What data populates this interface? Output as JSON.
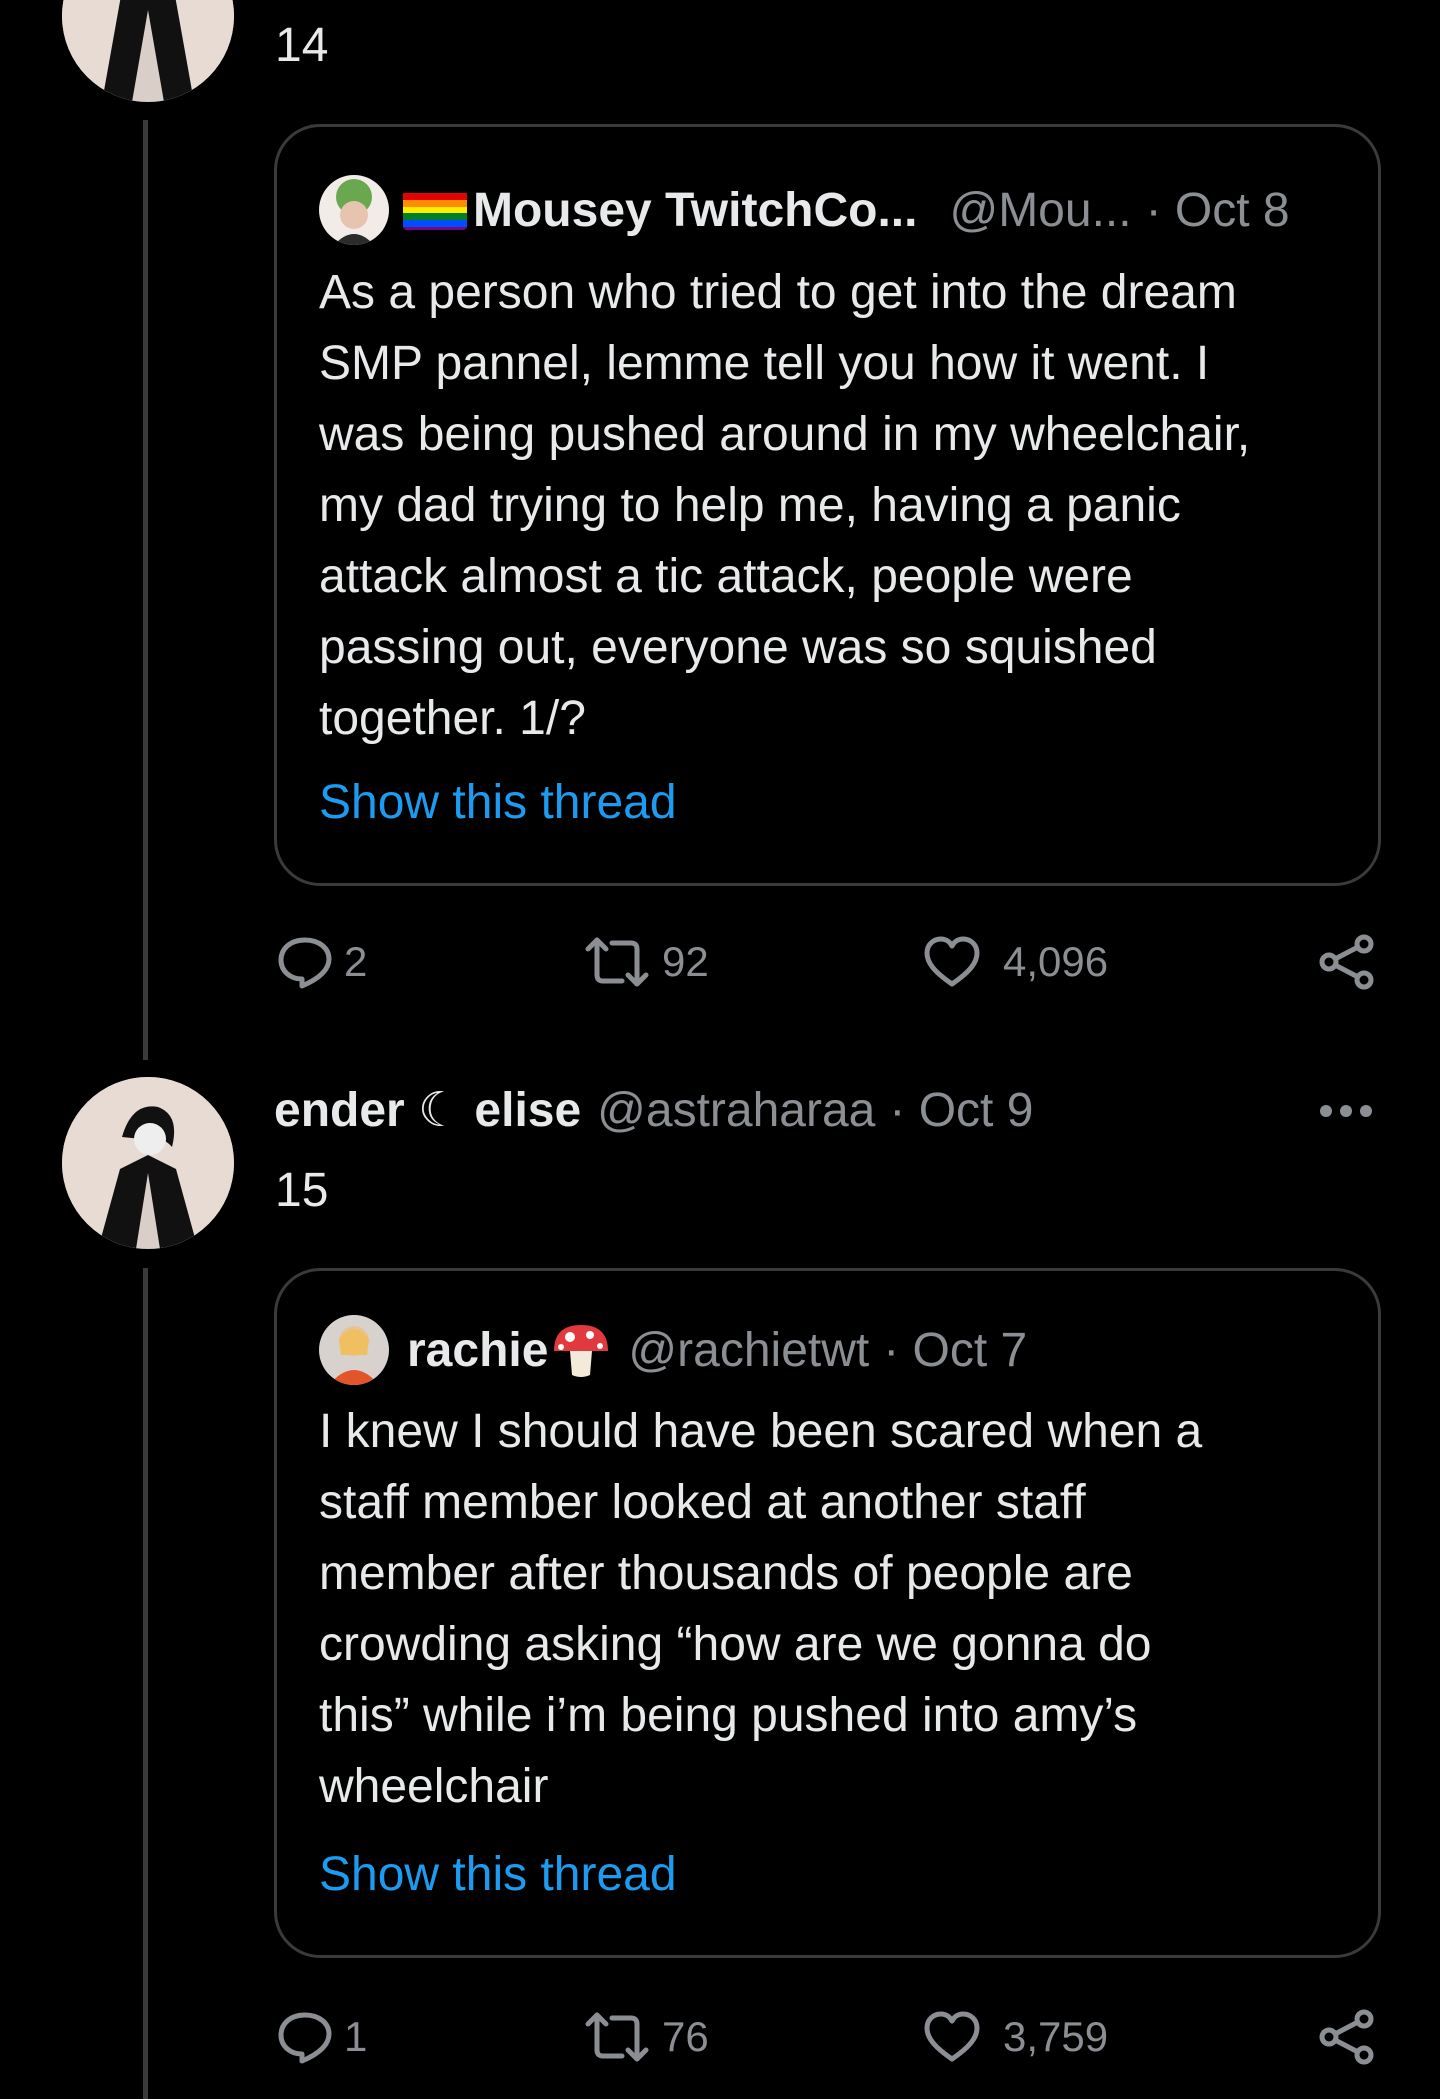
{
  "tweet_prev": {
    "body": "14",
    "quote": {
      "name": "Mousey TwitchCo...",
      "handle": "@Mou...",
      "date": "· Oct 8",
      "lines": [
        "As a person who tried to get into the dream",
        "SMP pannel, lemme tell you how it went. I",
        "was being pushed around in my wheelchair,",
        "my dad trying to help me, having a panic",
        "attack almost a tic attack, people were",
        "passing out, everyone was so squished",
        "together. 1/?"
      ],
      "show_thread": "Show this thread"
    },
    "actions": {
      "replies": "2",
      "retweets": "92",
      "likes": "4,096"
    }
  },
  "tweet_15": {
    "name": "ender ☾ elise",
    "handle": "@astraharaa",
    "date": "· Oct 9",
    "body": "15",
    "quote": {
      "name": "rachie",
      "emoji": "🍄",
      "handle": "@rachietwt",
      "date": "· Oct 7",
      "lines": [
        "I knew I should have been scared when a",
        "staff member looked at another staff",
        "member after thousands of people are",
        "crowding asking “how are we gonna do",
        "this” while i’m being pushed into amy’s",
        "wheelchair"
      ],
      "show_thread": "Show this thread"
    },
    "actions": {
      "replies": "1",
      "retweets": "76",
      "likes": "3,759"
    }
  },
  "colors": {
    "link": "#1d9bf0",
    "muted": "#8b8f94",
    "border": "#3a3a3a",
    "background": "#000000"
  }
}
